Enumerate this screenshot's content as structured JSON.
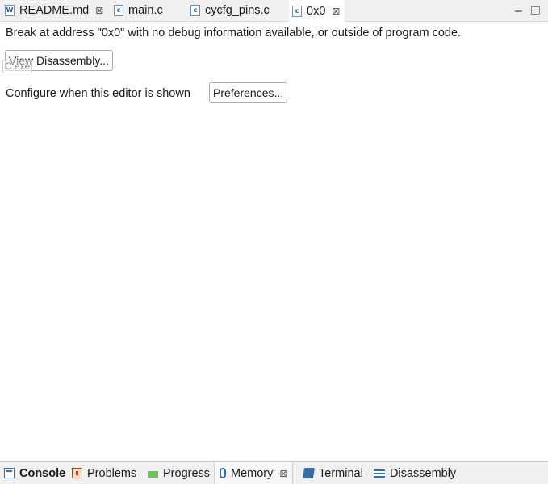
{
  "tabs": [
    {
      "label": "README.md",
      "icon": "markdown-file-icon",
      "glyph": "W",
      "close": "⊠",
      "active": false
    },
    {
      "label": "main.c",
      "icon": "c-file-icon",
      "glyph": "c",
      "active": false
    },
    {
      "label": "cycfg_pins.c",
      "icon": "c-file-icon",
      "glyph": "c",
      "active": false
    },
    {
      "label": "0x0",
      "icon": "c-file-icon",
      "glyph": "c",
      "close": "⊠",
      "active": true
    }
  ],
  "editor": {
    "message": "Break at address \"0x0\" with no debug information available, or outside of program code.",
    "view_disassembly_label": "View Disassembly...",
    "ghost_label": "C.exe",
    "configure_text": "Configure when this editor is shown",
    "preferences_label": "Preferences..."
  },
  "bottom_views": [
    {
      "label": "Console",
      "icon": "console-icon",
      "bold": true
    },
    {
      "label": "Problems",
      "icon": "problems-icon"
    },
    {
      "label": "Progress",
      "icon": "progress-icon"
    },
    {
      "label": "Memory",
      "icon": "memory-icon",
      "close": "⊠",
      "selected": true
    },
    {
      "label": "Terminal",
      "icon": "terminal-icon"
    },
    {
      "label": "Disassembly",
      "icon": "disassembly-icon"
    }
  ],
  "colors": {
    "accent": "#2f6fb0",
    "tabbar_bg": "#f0f0f0"
  }
}
